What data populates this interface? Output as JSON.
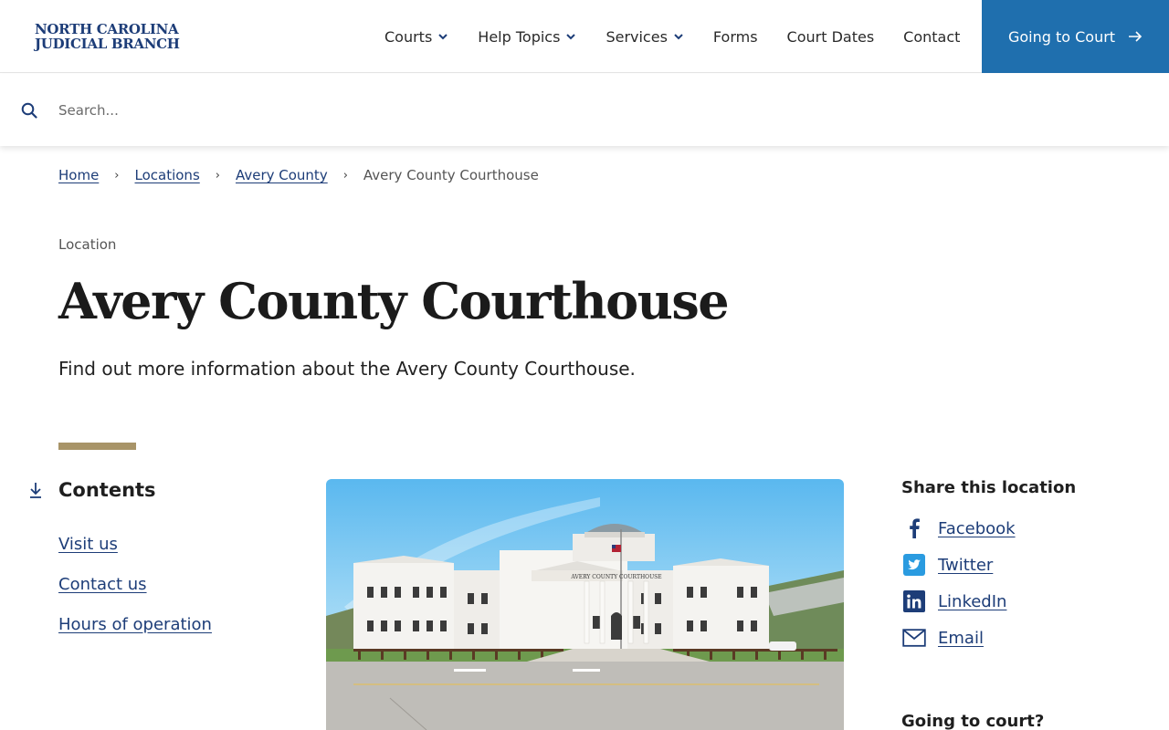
{
  "header": {
    "logo_line1": "NORTH CAROLINA",
    "logo_line2": "JUDICIAL BRANCH",
    "nav": [
      {
        "label": "Courts",
        "dropdown": true
      },
      {
        "label": "Help Topics",
        "dropdown": true
      },
      {
        "label": "Services",
        "dropdown": true
      },
      {
        "label": "Forms",
        "dropdown": false
      },
      {
        "label": "Court Dates",
        "dropdown": false
      },
      {
        "label": "Contact",
        "dropdown": false
      }
    ],
    "cta_label": "Going to Court",
    "cta_color": "#1f6fae"
  },
  "search": {
    "placeholder": "Search..."
  },
  "breadcrumb": {
    "items": [
      "Home",
      "Locations",
      "Avery County"
    ],
    "current": "Avery County Courthouse"
  },
  "page": {
    "eyebrow": "Location",
    "title": "Avery County Courthouse",
    "intro": "Find out more information about the Avery County Courthouse."
  },
  "contents": {
    "heading": "Contents",
    "links": [
      "Visit us",
      "Contact us",
      "Hours of operation"
    ]
  },
  "share": {
    "heading": "Share this location",
    "items": [
      {
        "label": "Facebook",
        "icon": "facebook-icon"
      },
      {
        "label": "Twitter",
        "icon": "twitter-icon"
      },
      {
        "label": "LinkedIn",
        "icon": "linkedin-icon"
      },
      {
        "label": "Email",
        "icon": "email-icon"
      }
    ]
  },
  "sidebar_next_heading": "Going to court?",
  "photo_sign_text": "AVERY COUNTY COURTHOUSE",
  "colors": {
    "link": "#1d3d78",
    "accent_rule": "#a89468",
    "brand_blue": "#1d3d78"
  }
}
